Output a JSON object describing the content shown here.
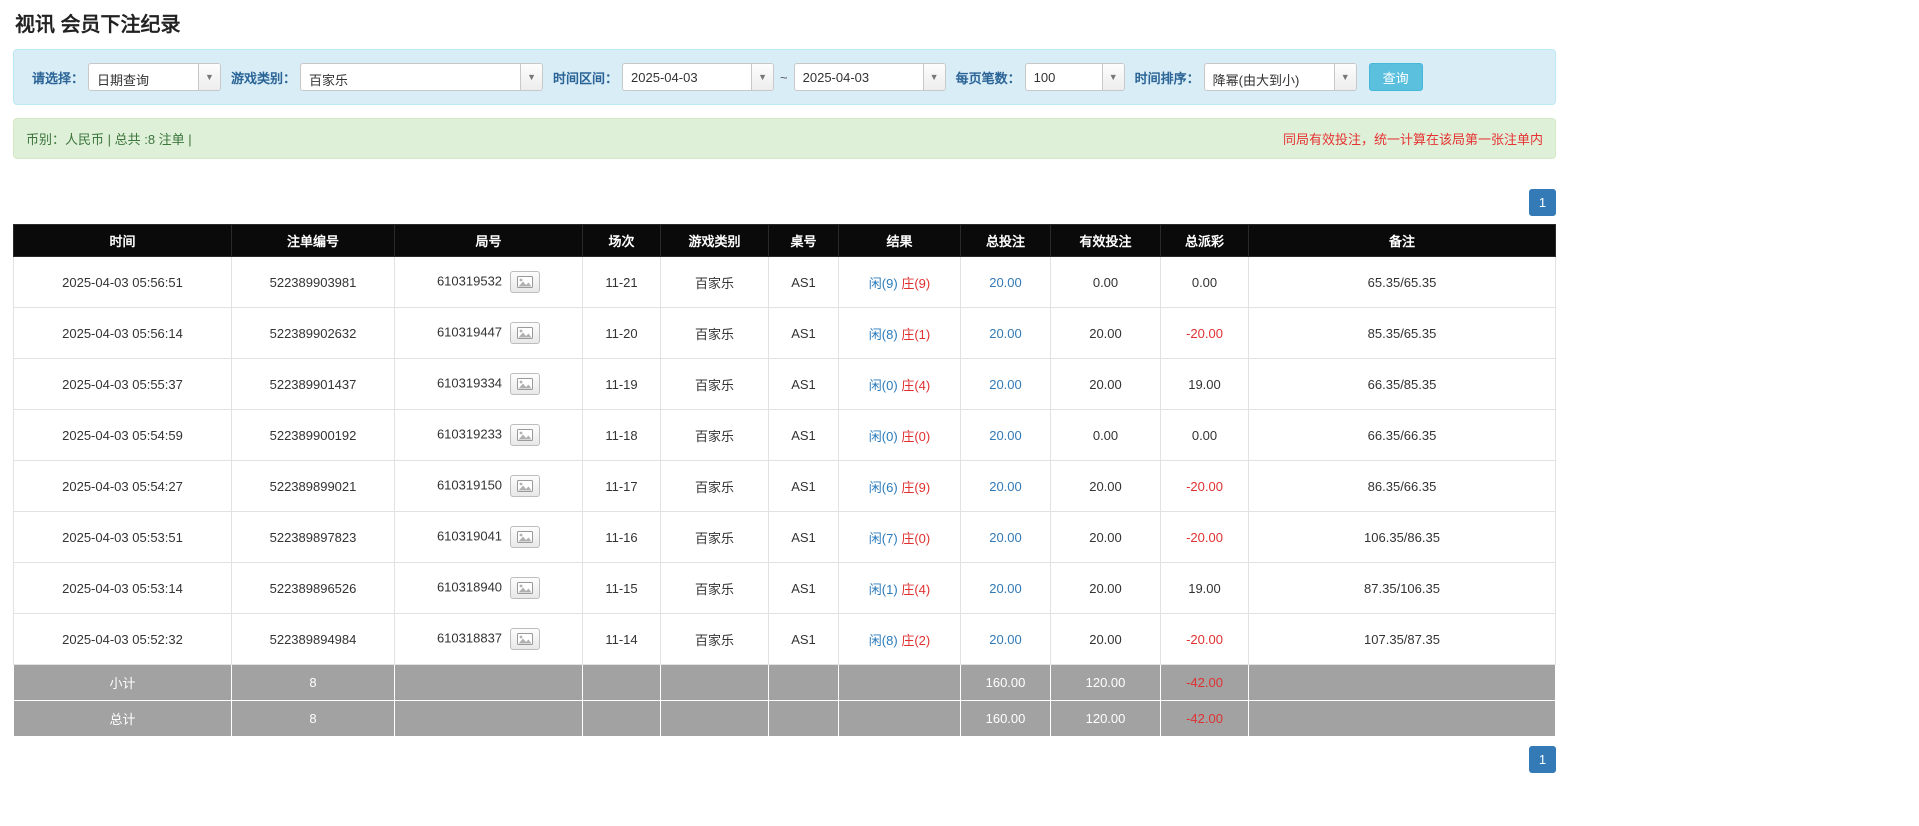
{
  "page": {
    "title": "视讯 会员下注纪录"
  },
  "filters": {
    "select_label": "请选择：",
    "select_value": "日期查询",
    "game_label": "游戏类别：",
    "game_value": "百家乐",
    "time_label": "时间区间：",
    "time_from": "2025-04-03",
    "time_separator": "~",
    "time_to": "2025-04-03",
    "per_page_label": "每页笔数：",
    "per_page_value": "100",
    "sort_label": "时间排序：",
    "sort_value": "降幂(由大到小)",
    "search_button": "查询"
  },
  "summary": {
    "left": "币别：人民币 | 总共 :8 注单 |",
    "right": "同局有效投注，统一计算在该局第一张注单内"
  },
  "pagination": {
    "page": "1"
  },
  "icons": {
    "combo_arrow": "chevron-down-icon",
    "round_detail": "roadmap-image-icon"
  },
  "colors": {
    "header_bg": "#0a0a0a",
    "footer_bg": "#a2a2a2",
    "filter_bg": "#d9edf7",
    "summary_bg": "#dff0d8",
    "accent_blue": "#337ab7",
    "negative_red": "#e03131",
    "search_btn": "#5bc0de"
  },
  "table": {
    "headers": [
      "时间",
      "注单编号",
      "局号",
      "场次",
      "游戏类别",
      "桌号",
      "结果",
      "总投注",
      "有效投注",
      "总派彩",
      "备注"
    ],
    "rows": [
      {
        "time": "2025-04-03 05:56:51",
        "bet_id": "522389903981",
        "round_id": "610319532",
        "session": "11-21",
        "game": "百家乐",
        "table": "AS1",
        "result_player": "闲(9)",
        "result_banker": "庄(9)",
        "total_bet": "20.00",
        "valid_bet": "0.00",
        "payout": "0.00",
        "remark": "65.35/65.35"
      },
      {
        "time": "2025-04-03 05:56:14",
        "bet_id": "522389902632",
        "round_id": "610319447",
        "session": "11-20",
        "game": "百家乐",
        "table": "AS1",
        "result_player": "闲(8)",
        "result_banker": "庄(1)",
        "total_bet": "20.00",
        "valid_bet": "20.00",
        "payout": "-20.00",
        "remark": "85.35/65.35"
      },
      {
        "time": "2025-04-03 05:55:37",
        "bet_id": "522389901437",
        "round_id": "610319334",
        "session": "11-19",
        "game": "百家乐",
        "table": "AS1",
        "result_player": "闲(0)",
        "result_banker": "庄(4)",
        "total_bet": "20.00",
        "valid_bet": "20.00",
        "payout": "19.00",
        "remark": "66.35/85.35"
      },
      {
        "time": "2025-04-03 05:54:59",
        "bet_id": "522389900192",
        "round_id": "610319233",
        "session": "11-18",
        "game": "百家乐",
        "table": "AS1",
        "result_player": "闲(0)",
        "result_banker": "庄(0)",
        "total_bet": "20.00",
        "valid_bet": "0.00",
        "payout": "0.00",
        "remark": "66.35/66.35"
      },
      {
        "time": "2025-04-03 05:54:27",
        "bet_id": "522389899021",
        "round_id": "610319150",
        "session": "11-17",
        "game": "百家乐",
        "table": "AS1",
        "result_player": "闲(6)",
        "result_banker": "庄(9)",
        "total_bet": "20.00",
        "valid_bet": "20.00",
        "payout": "-20.00",
        "remark": "86.35/66.35"
      },
      {
        "time": "2025-04-03 05:53:51",
        "bet_id": "522389897823",
        "round_id": "610319041",
        "session": "11-16",
        "game": "百家乐",
        "table": "AS1",
        "result_player": "闲(7)",
        "result_banker": "庄(0)",
        "total_bet": "20.00",
        "valid_bet": "20.00",
        "payout": "-20.00",
        "remark": "106.35/86.35"
      },
      {
        "time": "2025-04-03 05:53:14",
        "bet_id": "522389896526",
        "round_id": "610318940",
        "session": "11-15",
        "game": "百家乐",
        "table": "AS1",
        "result_player": "闲(1)",
        "result_banker": "庄(4)",
        "total_bet": "20.00",
        "valid_bet": "20.00",
        "payout": "19.00",
        "remark": "87.35/106.35"
      },
      {
        "time": "2025-04-03 05:52:32",
        "bet_id": "522389894984",
        "round_id": "610318837",
        "session": "11-14",
        "game": "百家乐",
        "table": "AS1",
        "result_player": "闲(8)",
        "result_banker": "庄(2)",
        "total_bet": "20.00",
        "valid_bet": "20.00",
        "payout": "-20.00",
        "remark": "107.35/87.35"
      }
    ],
    "subtotal": {
      "label": "小计",
      "count": "8",
      "total_bet": "160.00",
      "valid_bet": "120.00",
      "payout": "-42.00"
    },
    "total": {
      "label": "总计",
      "count": "8",
      "total_bet": "160.00",
      "valid_bet": "120.00",
      "payout": "-42.00"
    }
  }
}
